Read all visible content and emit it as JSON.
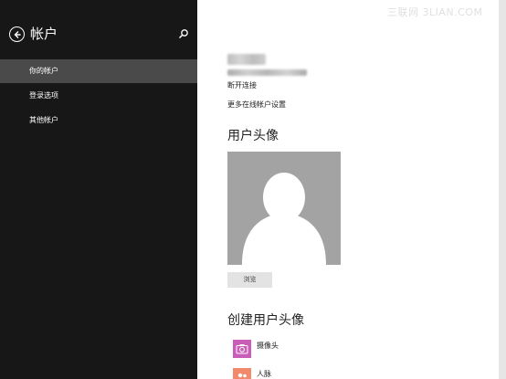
{
  "sidebar": {
    "title": "帐户",
    "items": [
      {
        "label": "你的帐户"
      },
      {
        "label": "登录选项"
      },
      {
        "label": "其他帐户"
      }
    ]
  },
  "account": {
    "disconnect_label": "断开连接",
    "more_settings_label": "更多在线帐户设置"
  },
  "avatar_section": {
    "title": "用户头像",
    "browse_label": "浏览"
  },
  "create_section": {
    "title": "创建用户头像",
    "items": [
      {
        "label": "摄像头",
        "icon": "camera-icon",
        "color": "#c95db8"
      },
      {
        "label": "人脉",
        "icon": "people-icon",
        "color": "#f08a6a"
      }
    ]
  },
  "watermark": "三联网 3LIAN.COM",
  "colors": {
    "sidebar_bg": "#171717",
    "selected_bg": "#4a4a4a",
    "avatar_bg": "#a3a3a3"
  }
}
